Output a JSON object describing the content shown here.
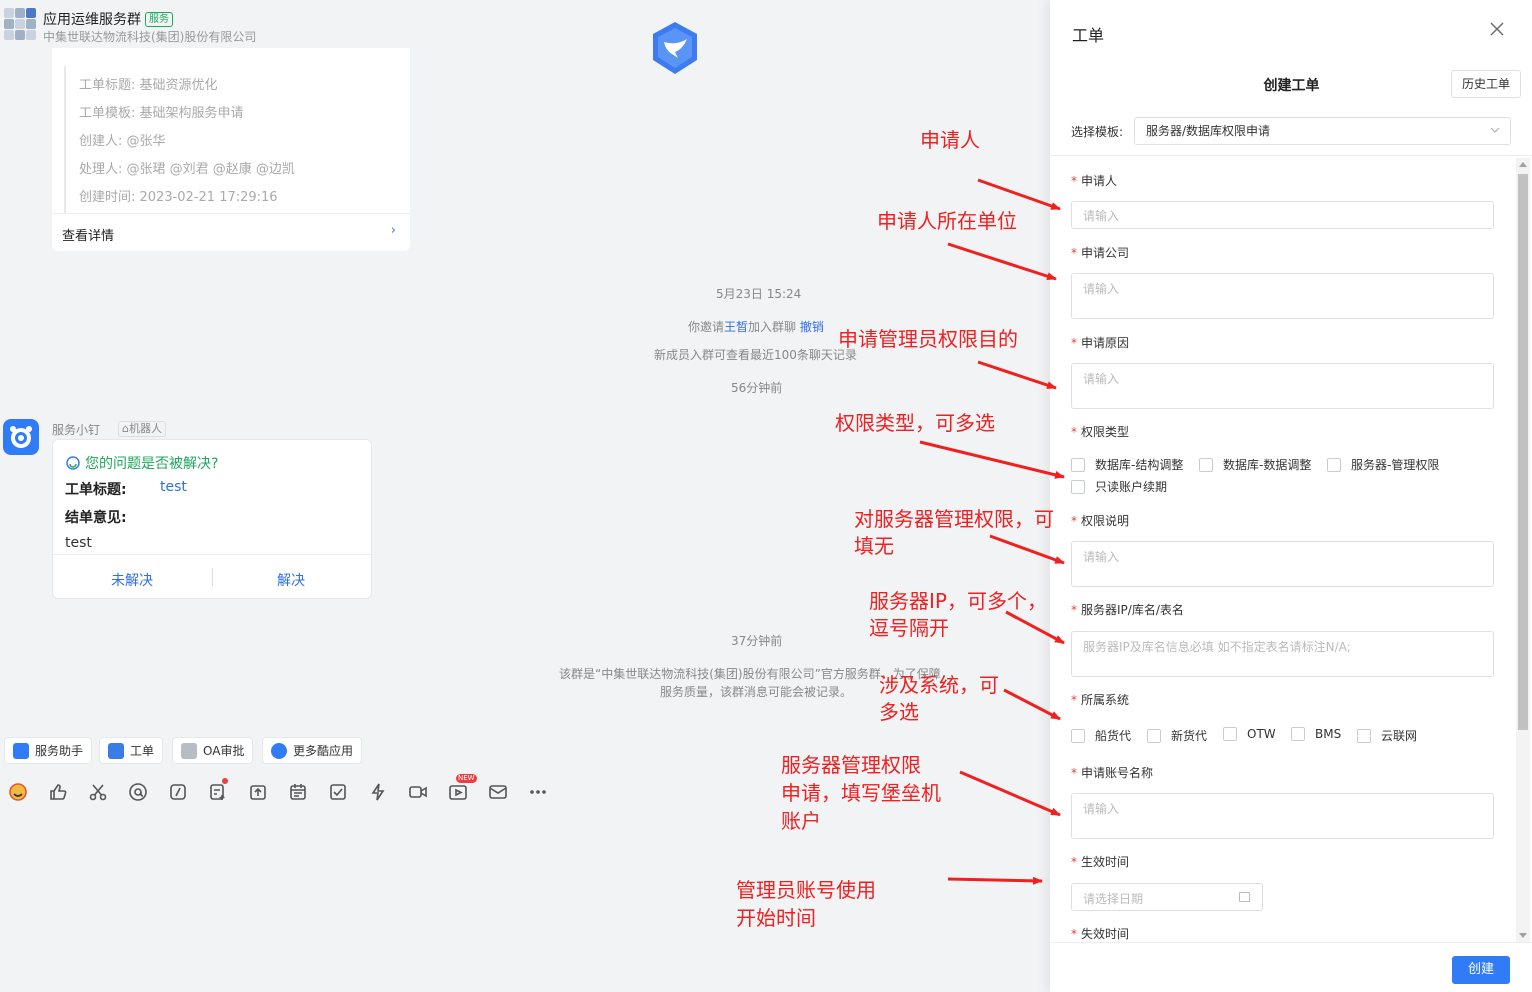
{
  "chat": {
    "group_name": "应用运维服务群",
    "group_badge": "服务",
    "group_org": "中集世联达物流科技(集团)股份有限公司",
    "ticket_card": {
      "title_line": "工单标题: 基础资源优化",
      "template_line": "工单模板: 基础架构服务申请",
      "creator_line": "创建人: @张华",
      "handler_line": "处理人: @张珺 @刘君 @赵康 @边凯",
      "created_line": "创建时间: 2023-02-21 17:29:16",
      "detail_label": "查看详情",
      "chevron": "›"
    },
    "system_messages": {
      "date": "5月23日 15:24",
      "invite_prefix": "你邀请",
      "invite_name": "王晳",
      "invite_suffix": "加入群聊",
      "revoke": "撤销",
      "new_member_note": "新成员入群可查看最近100条聊天记录",
      "time1": "56分钟前",
      "time2": "37分钟前",
      "official_note_1": "该群是“中集世联达物流科技(集团)股份有限公司”官方服务群，为了保障",
      "official_note_2": "服务质量，该群消息可能会被记录。"
    },
    "bot": {
      "name": "服务小钉",
      "tag": "机器人",
      "question": "您的问题是否被解决?",
      "title_key": "工单标题:",
      "title_value": "test",
      "opinion_key": "结单意见:",
      "opinion_value": "test",
      "unresolved": "未解决",
      "resolved": "解决"
    },
    "quick_apps": [
      "服务助手",
      "工单",
      "OA审批",
      "更多酷应用"
    ],
    "toolbar_new_tag": "NEW"
  },
  "annotations": [
    "申请人",
    "申请人所在单位",
    "申请管理员权限目的",
    "权限类型，可多选",
    "对服务器管理权限，可",
    "填无",
    "服务器IP，可多个，",
    "逗号隔开",
    "涉及系统，可",
    "多选",
    "服务器管理权限",
    "申请，填写堡垒机",
    "账户",
    "管理员账号使用",
    "开始时间"
  ],
  "panel": {
    "title": "工单",
    "subtitle": "创建工单",
    "history_button": "历史工单",
    "template_label": "选择模板:",
    "template_value": "服务器/数据库权限申请",
    "fields": {
      "applicant": {
        "label": "申请人",
        "placeholder": "请输入"
      },
      "company": {
        "label": "申请公司",
        "placeholder": "请输入"
      },
      "reason": {
        "label": "申请原因",
        "placeholder": "请输入"
      },
      "perm_type": {
        "label": "权限类型",
        "options": [
          "数据库-结构调整",
          "数据库-数据调整",
          "服务器-管理权限",
          "只读账户续期"
        ]
      },
      "perm_desc": {
        "label": "权限说明",
        "placeholder": "请输入"
      },
      "server_ip": {
        "label": "服务器IP/库名/表名",
        "placeholder": "服务器IP及库名信息必填 如不指定表名请标注N/A;"
      },
      "system": {
        "label": "所属系统",
        "options": [
          "船货代",
          "新货代",
          "OTW",
          "BMS",
          "云联网"
        ]
      },
      "account": {
        "label": "申请账号名称",
        "placeholder": "请输入"
      },
      "start_time": {
        "label": "生效时间",
        "placeholder": "请选择日期"
      },
      "end_time": {
        "label": "失效时间"
      }
    },
    "required_mark": "*",
    "create_button": "创建"
  }
}
